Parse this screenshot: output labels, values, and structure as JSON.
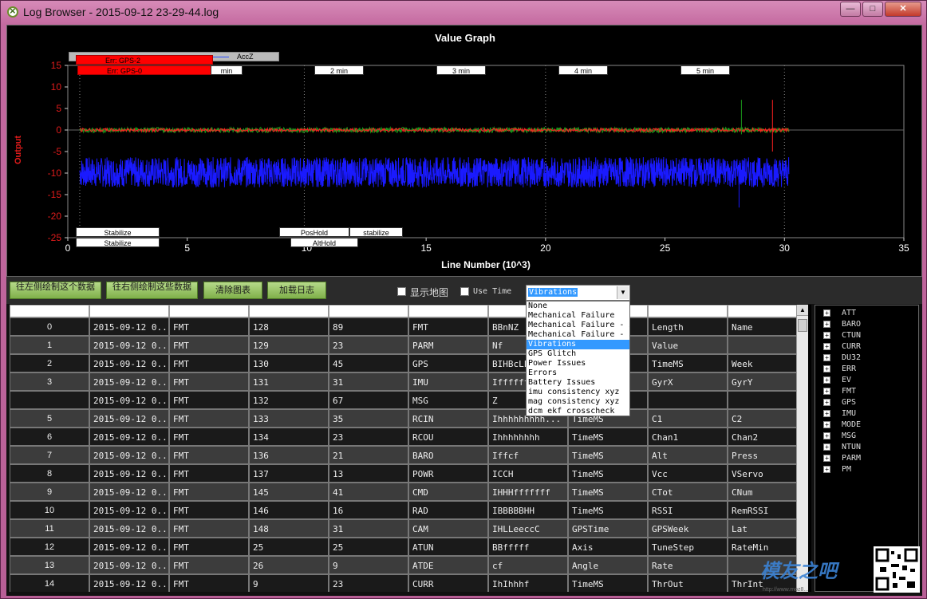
{
  "window": {
    "title": "Log Browser - 2015-09-12 23-29-44.log",
    "minimize": "—",
    "maximize": "□",
    "close": "✕"
  },
  "graph": {
    "title": "Value Graph",
    "xlabel": "Line Number (10^3)",
    "ylabel": "Output",
    "legend": "AccZ",
    "errors": [
      "Err: GPS-2",
      "Err: GPS-0"
    ],
    "time_labels": [
      "min",
      "2 min",
      "3 min",
      "4 min",
      "5 min"
    ],
    "modes": [
      "Stabilize",
      "Stabilize",
      "PosHold",
      "AltHold",
      "stabilize"
    ],
    "xticks": [
      "0",
      "5",
      "10",
      "15",
      "20",
      "25",
      "30",
      "35"
    ],
    "yticks": [
      "15",
      "10",
      "5",
      "0",
      "-5",
      "-10",
      "-15",
      "-20",
      "-25"
    ],
    "colors": {
      "accz": "#1a1aff",
      "red_series": "#ff2020",
      "green_series": "#1b9a1b"
    }
  },
  "chart_data": {
    "type": "line",
    "xlabel": "Line Number (10^3)",
    "ylabel": "Output",
    "xlim": [
      0,
      35
    ],
    "ylim": [
      -25,
      15
    ],
    "series": [
      {
        "name": "AccZ",
        "x": [
          0.5,
          30.2
        ],
        "values": [
          -9.8,
          -9.8
        ]
      }
    ]
  },
  "toolbar": {
    "btn_left": "往左侧绘制这个数据",
    "btn_right": "往右侧绘制这些数据",
    "btn_clear": "清除图表",
    "btn_load": "加载日志",
    "show_map": "显示地图",
    "use_time": "Use Time",
    "combo_value": "Vibrations",
    "combo_arrow": "▼"
  },
  "dropdown": [
    "None",
    "Mechanical Failure",
    "Mechanical Failure - x",
    "Mechanical Failure - ",
    "Vibrations",
    "GPS Glitch",
    "Power Issues",
    "Errors",
    "Battery Issues",
    "imu consistency xyz",
    "mag consistency xyz",
    "dcm ekf crosscheck"
  ],
  "table": {
    "rows": [
      [
        "0",
        "2015-09-12 0...",
        "FMT",
        "128",
        "89",
        "FMT",
        "BBnNZ",
        "",
        "Length",
        "Name"
      ],
      [
        "1",
        "2015-09-12 0...",
        "FMT",
        "129",
        "23",
        "PARM",
        "Nf",
        "",
        "Value",
        ""
      ],
      [
        "2",
        "2015-09-12 0...",
        "FMT",
        "130",
        "45",
        "GPS",
        "BIHBcLLe",
        "",
        "TimeMS",
        "Week"
      ],
      [
        "3",
        "2015-09-12 0...",
        "FMT",
        "131",
        "31",
        "IMU",
        "Iffffff",
        "",
        "GyrX",
        "GyrY"
      ],
      [
        "",
        "2015-09-12 0...",
        "FMT",
        "132",
        "67",
        "MSG",
        "Z",
        "",
        "",
        ""
      ],
      [
        "5",
        "2015-09-12 0...",
        "FMT",
        "133",
        "35",
        "RCIN",
        "Ihhhhhhhhh...",
        "TimeMS",
        "C1",
        "C2"
      ],
      [
        "6",
        "2015-09-12 0...",
        "FMT",
        "134",
        "23",
        "RCOU",
        "Ihhhhhhhh",
        "TimeMS",
        "Chan1",
        "Chan2"
      ],
      [
        "7",
        "2015-09-12 0...",
        "FMT",
        "136",
        "21",
        "BARO",
        "Iffcf",
        "TimeMS",
        "Alt",
        "Press"
      ],
      [
        "8",
        "2015-09-12 0...",
        "FMT",
        "137",
        "13",
        "POWR",
        "ICCH",
        "TimeMS",
        "Vcc",
        "VServo"
      ],
      [
        "9",
        "2015-09-12 0...",
        "FMT",
        "145",
        "41",
        "CMD",
        "IHHHfffffff",
        "TimeMS",
        "CTot",
        "CNum"
      ],
      [
        "10",
        "2015-09-12 0...",
        "FMT",
        "146",
        "16",
        "RAD",
        "IBBBBBHH",
        "TimeMS",
        "RSSI",
        "RemRSSI"
      ],
      [
        "11",
        "2015-09-12 0...",
        "FMT",
        "148",
        "31",
        "CAM",
        "IHLLeeccC",
        "GPSTime",
        "GPSWeek",
        "Lat"
      ],
      [
        "12",
        "2015-09-12 0...",
        "FMT",
        "25",
        "25",
        "ATUN",
        "BBfffff",
        "Axis",
        "TuneStep",
        "RateMin"
      ],
      [
        "13",
        "2015-09-12 0...",
        "FMT",
        "26",
        "9",
        "ATDE",
        "cf",
        "Angle",
        "Rate",
        ""
      ],
      [
        "14",
        "2015-09-12 0...",
        "FMT",
        "9",
        "23",
        "CURR",
        "IhIhhhf",
        "TimeMS",
        "ThrOut",
        "ThrInt"
      ]
    ],
    "scroll_up": "▲"
  },
  "tree": [
    "ATT",
    "BARO",
    "CTUN",
    "CURR",
    "DU32",
    "ERR",
    "EV",
    "FMT",
    "GPS",
    "IMU",
    "MODE",
    "MSG",
    "NTUN",
    "PARM",
    "PM"
  ],
  "watermark": {
    "text": "模友之吧",
    "url": "http://www.moz8..."
  }
}
